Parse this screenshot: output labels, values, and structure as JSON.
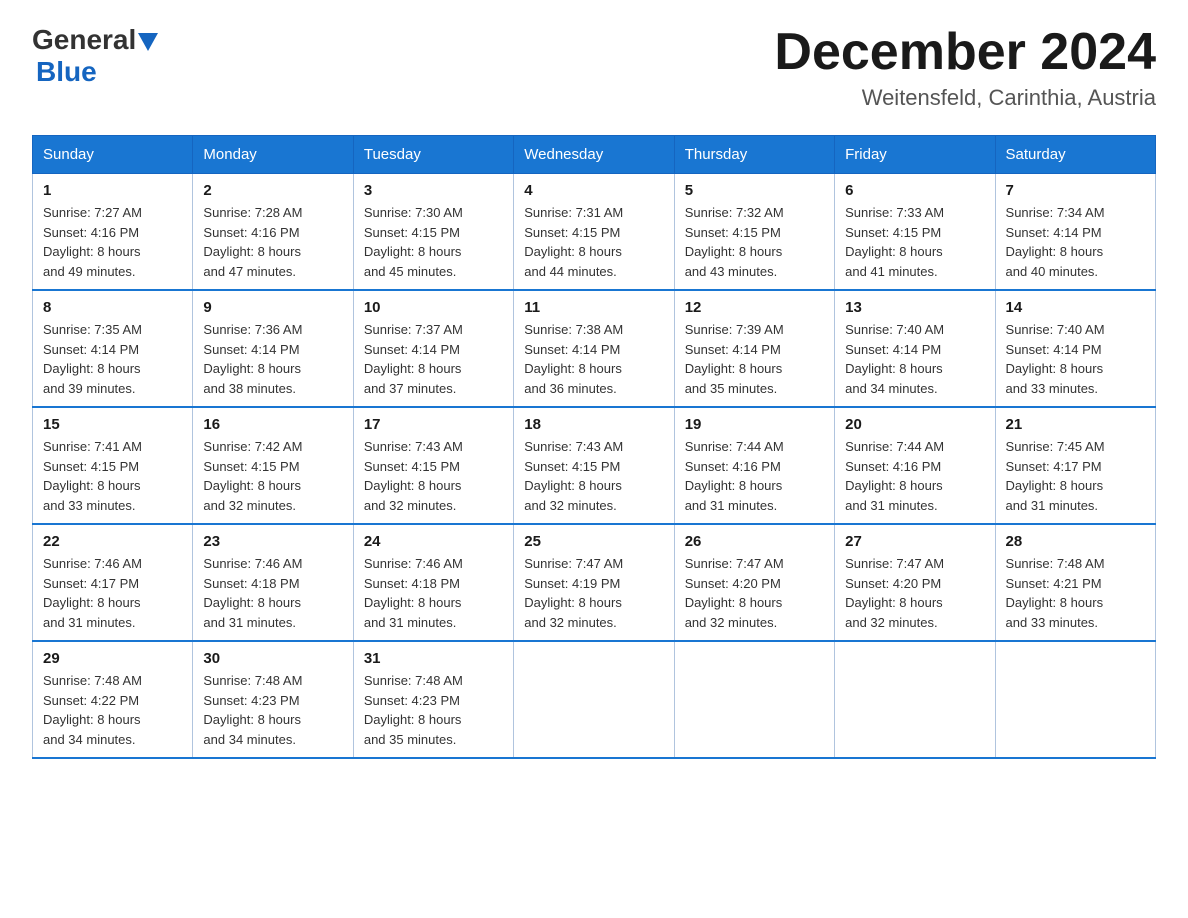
{
  "logo": {
    "general": "General",
    "blue": "Blue"
  },
  "title": "December 2024",
  "subtitle": "Weitensfeld, Carinthia, Austria",
  "days_of_week": [
    "Sunday",
    "Monday",
    "Tuesday",
    "Wednesday",
    "Thursday",
    "Friday",
    "Saturday"
  ],
  "weeks": [
    [
      {
        "day": "1",
        "sunrise": "7:27 AM",
        "sunset": "4:16 PM",
        "daylight": "8 hours and 49 minutes."
      },
      {
        "day": "2",
        "sunrise": "7:28 AM",
        "sunset": "4:16 PM",
        "daylight": "8 hours and 47 minutes."
      },
      {
        "day": "3",
        "sunrise": "7:30 AM",
        "sunset": "4:15 PM",
        "daylight": "8 hours and 45 minutes."
      },
      {
        "day": "4",
        "sunrise": "7:31 AM",
        "sunset": "4:15 PM",
        "daylight": "8 hours and 44 minutes."
      },
      {
        "day": "5",
        "sunrise": "7:32 AM",
        "sunset": "4:15 PM",
        "daylight": "8 hours and 43 minutes."
      },
      {
        "day": "6",
        "sunrise": "7:33 AM",
        "sunset": "4:15 PM",
        "daylight": "8 hours and 41 minutes."
      },
      {
        "day": "7",
        "sunrise": "7:34 AM",
        "sunset": "4:14 PM",
        "daylight": "8 hours and 40 minutes."
      }
    ],
    [
      {
        "day": "8",
        "sunrise": "7:35 AM",
        "sunset": "4:14 PM",
        "daylight": "8 hours and 39 minutes."
      },
      {
        "day": "9",
        "sunrise": "7:36 AM",
        "sunset": "4:14 PM",
        "daylight": "8 hours and 38 minutes."
      },
      {
        "day": "10",
        "sunrise": "7:37 AM",
        "sunset": "4:14 PM",
        "daylight": "8 hours and 37 minutes."
      },
      {
        "day": "11",
        "sunrise": "7:38 AM",
        "sunset": "4:14 PM",
        "daylight": "8 hours and 36 minutes."
      },
      {
        "day": "12",
        "sunrise": "7:39 AM",
        "sunset": "4:14 PM",
        "daylight": "8 hours and 35 minutes."
      },
      {
        "day": "13",
        "sunrise": "7:40 AM",
        "sunset": "4:14 PM",
        "daylight": "8 hours and 34 minutes."
      },
      {
        "day": "14",
        "sunrise": "7:40 AM",
        "sunset": "4:14 PM",
        "daylight": "8 hours and 33 minutes."
      }
    ],
    [
      {
        "day": "15",
        "sunrise": "7:41 AM",
        "sunset": "4:15 PM",
        "daylight": "8 hours and 33 minutes."
      },
      {
        "day": "16",
        "sunrise": "7:42 AM",
        "sunset": "4:15 PM",
        "daylight": "8 hours and 32 minutes."
      },
      {
        "day": "17",
        "sunrise": "7:43 AM",
        "sunset": "4:15 PM",
        "daylight": "8 hours and 32 minutes."
      },
      {
        "day": "18",
        "sunrise": "7:43 AM",
        "sunset": "4:15 PM",
        "daylight": "8 hours and 32 minutes."
      },
      {
        "day": "19",
        "sunrise": "7:44 AM",
        "sunset": "4:16 PM",
        "daylight": "8 hours and 31 minutes."
      },
      {
        "day": "20",
        "sunrise": "7:44 AM",
        "sunset": "4:16 PM",
        "daylight": "8 hours and 31 minutes."
      },
      {
        "day": "21",
        "sunrise": "7:45 AM",
        "sunset": "4:17 PM",
        "daylight": "8 hours and 31 minutes."
      }
    ],
    [
      {
        "day": "22",
        "sunrise": "7:46 AM",
        "sunset": "4:17 PM",
        "daylight": "8 hours and 31 minutes."
      },
      {
        "day": "23",
        "sunrise": "7:46 AM",
        "sunset": "4:18 PM",
        "daylight": "8 hours and 31 minutes."
      },
      {
        "day": "24",
        "sunrise": "7:46 AM",
        "sunset": "4:18 PM",
        "daylight": "8 hours and 31 minutes."
      },
      {
        "day": "25",
        "sunrise": "7:47 AM",
        "sunset": "4:19 PM",
        "daylight": "8 hours and 32 minutes."
      },
      {
        "day": "26",
        "sunrise": "7:47 AM",
        "sunset": "4:20 PM",
        "daylight": "8 hours and 32 minutes."
      },
      {
        "day": "27",
        "sunrise": "7:47 AM",
        "sunset": "4:20 PM",
        "daylight": "8 hours and 32 minutes."
      },
      {
        "day": "28",
        "sunrise": "7:48 AM",
        "sunset": "4:21 PM",
        "daylight": "8 hours and 33 minutes."
      }
    ],
    [
      {
        "day": "29",
        "sunrise": "7:48 AM",
        "sunset": "4:22 PM",
        "daylight": "8 hours and 34 minutes."
      },
      {
        "day": "30",
        "sunrise": "7:48 AM",
        "sunset": "4:23 PM",
        "daylight": "8 hours and 34 minutes."
      },
      {
        "day": "31",
        "sunrise": "7:48 AM",
        "sunset": "4:23 PM",
        "daylight": "8 hours and 35 minutes."
      },
      null,
      null,
      null,
      null
    ]
  ],
  "labels": {
    "sunrise": "Sunrise:",
    "sunset": "Sunset:",
    "daylight": "Daylight:"
  }
}
